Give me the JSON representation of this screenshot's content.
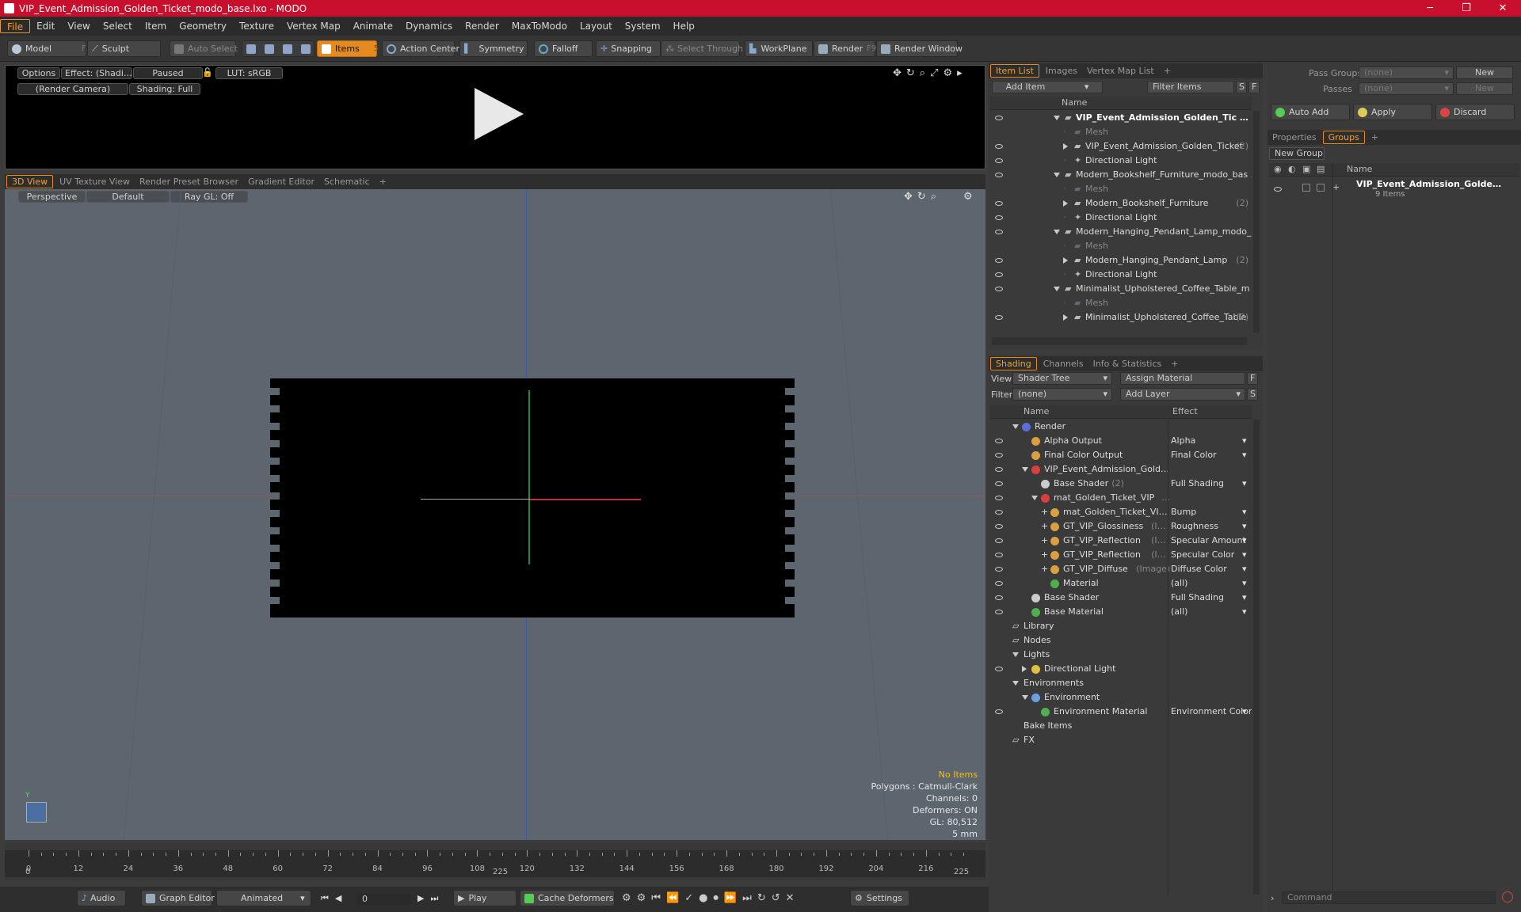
{
  "window": {
    "title": "VIP_Event_Admission_Golden_Ticket_modo_base.lxo - MODO",
    "minimize": "─",
    "maximize": "❐",
    "close": "✕"
  },
  "menu": [
    "File",
    "Edit",
    "View",
    "Select",
    "Item",
    "Geometry",
    "Texture",
    "Vertex Map",
    "Animate",
    "Dynamics",
    "Render",
    "MaxToModo",
    "Layout",
    "System",
    "Help"
  ],
  "toolbar": {
    "model": "Model",
    "model_key": "F2",
    "sculpt": "Sculpt",
    "auto_select": "Auto Select",
    "items": "Items",
    "items_key": "5",
    "action_center": "Action Center",
    "symmetry": "Symmetry",
    "falloff": "Falloff",
    "snapping": "Snapping",
    "select_through": "Select Through",
    "workplane": "WorkPlane",
    "render": "Render",
    "render_key": "F9",
    "render_window": "Render Window"
  },
  "preview": {
    "options": "Options",
    "effect": "Effect: (Shadi…",
    "paused": "Paused",
    "lut": "LUT: sRGB",
    "camera": "(Render Camera)",
    "shading": "Shading: Full"
  },
  "view_tabs": [
    "3D View",
    "UV Texture View",
    "Render Preset Browser",
    "Gradient Editor",
    "Schematic",
    "+"
  ],
  "viewport": {
    "perspective": "Perspective",
    "default": "Default",
    "raygl": "Ray GL: Off",
    "stats": {
      "no_items": "No Items",
      "polygons": "Polygons : Catmull-Clark",
      "channels": "Channels: 0",
      "deformers": "Deformers: ON",
      "gl": "GL: 80,512",
      "scale": "5 mm"
    }
  },
  "timeline": {
    "ticks": [
      0,
      12,
      24,
      36,
      48,
      60,
      72,
      84,
      96,
      108,
      120,
      132,
      144,
      156,
      168,
      180,
      192,
      204,
      216
    ],
    "start": "0",
    "mid": "225",
    "end": "225"
  },
  "transport": {
    "audio": "Audio",
    "graph_editor": "Graph Editor",
    "animated": "Animated",
    "frame": "0",
    "play": "Play",
    "cache_deformers": "Cache Deformers",
    "settings": "Settings"
  },
  "item_list": {
    "tabs": [
      "Item List",
      "Images",
      "Vertex Map List",
      "+"
    ],
    "add_item": "Add Item",
    "filter_items": "Filter Items",
    "s_btn": "S",
    "f_btn": "F",
    "col_name": "Name",
    "rows": [
      {
        "indent": 0,
        "text": "VIP_Event_Admission_Golden_Tic …",
        "style": "bold",
        "expand": "down"
      },
      {
        "indent": 1,
        "text": "Mesh",
        "style": "dim",
        "expand": ""
      },
      {
        "indent": 1,
        "text": "VIP_Event_Admission_Golden_Ticket",
        "suffix": "(2)",
        "style": "",
        "expand": "right"
      },
      {
        "indent": 1,
        "text": "Directional Light",
        "style": "",
        "expand": ""
      },
      {
        "indent": 0,
        "text": "Modern_Bookshelf_Furniture_modo_bas …",
        "style": "",
        "expand": "down"
      },
      {
        "indent": 1,
        "text": "Mesh",
        "style": "dim",
        "expand": ""
      },
      {
        "indent": 1,
        "text": "Modern_Bookshelf_Furniture",
        "suffix": "(2)",
        "style": "",
        "expand": "right"
      },
      {
        "indent": 1,
        "text": "Directional Light",
        "style": "",
        "expand": ""
      },
      {
        "indent": 0,
        "text": "Modern_Hanging_Pendant_Lamp_modo_…",
        "style": "",
        "expand": "down"
      },
      {
        "indent": 1,
        "text": "Mesh",
        "style": "dim",
        "expand": ""
      },
      {
        "indent": 1,
        "text": "Modern_Hanging_Pendant_Lamp",
        "suffix": "(2)",
        "style": "",
        "expand": "right"
      },
      {
        "indent": 1,
        "text": "Directional Light",
        "style": "",
        "expand": ""
      },
      {
        "indent": 0,
        "text": "Minimalist_Upholstered_Coffee_Table_m …",
        "style": "",
        "expand": "down"
      },
      {
        "indent": 1,
        "text": "Mesh",
        "style": "dim",
        "expand": ""
      },
      {
        "indent": 1,
        "text": "Minimalist_Upholstered_Coffee_Table",
        "suffix": "(2)",
        "style": "",
        "expand": "right"
      }
    ]
  },
  "shading": {
    "tabs": [
      "Shading",
      "Channels",
      "Info & Statistics",
      "+"
    ],
    "view_label": "View",
    "view_value": "Shader Tree",
    "assign_material": "Assign Material",
    "filter_label": "Filter",
    "filter_value": "(none)",
    "add_layer": "Add Layer",
    "f_btn": "F",
    "s_btn": "S",
    "col_name": "Name",
    "col_effect": "Effect",
    "rows": [
      {
        "indent": 0,
        "text": "Render",
        "effect": "",
        "color": "#5a6fd8",
        "expand": "down",
        "eye": false
      },
      {
        "indent": 1,
        "text": "Alpha Output",
        "effect": "Alpha",
        "color": "#d8a040",
        "expand": "",
        "eye": true
      },
      {
        "indent": 1,
        "text": "Final Color Output",
        "effect": "Final Color",
        "color": "#d8a040",
        "expand": "",
        "eye": true
      },
      {
        "indent": 1,
        "text": "VIP_Event_Admission_Gold…",
        "effect": "",
        "color": "#d84040",
        "expand": "down",
        "eye": true
      },
      {
        "indent": 2,
        "text": "Base Shader",
        "suffix": "(2)",
        "effect": "Full Shading",
        "color": "#cccccc",
        "expand": "",
        "eye": true
      },
      {
        "indent": 2,
        "text": "mat_Golden_Ticket_VIP",
        "suffix": "…",
        "effect": "",
        "color": "#d84040",
        "expand": "down",
        "eye": true
      },
      {
        "indent": 3,
        "text": "mat_Golden_Ticket_VI…",
        "effect": "Bump",
        "color": "#d8a040",
        "expand": "+",
        "eye": true
      },
      {
        "indent": 3,
        "text": "GT_VIP_Glossiness",
        "suffix": "(I…",
        "effect": "Roughness",
        "color": "#d8a040",
        "expand": "+",
        "eye": true
      },
      {
        "indent": 3,
        "text": "GT_VIP_Reflection",
        "suffix": "(I…",
        "effect": "Specular Amount",
        "color": "#d8a040",
        "expand": "+",
        "eye": true
      },
      {
        "indent": 3,
        "text": "GT_VIP_Reflection",
        "suffix": "(I…",
        "effect": "Specular Color",
        "color": "#d8a040",
        "expand": "+",
        "eye": true
      },
      {
        "indent": 3,
        "text": "GT_VIP_Diffuse",
        "suffix": "(Image)",
        "effect": "Diffuse Color",
        "color": "#d8a040",
        "expand": "+",
        "eye": true
      },
      {
        "indent": 3,
        "text": "Material",
        "effect": "(all)",
        "color": "#50b050",
        "expand": "",
        "eye": true
      },
      {
        "indent": 1,
        "text": "Base Shader",
        "effect": "Full Shading",
        "color": "#cccccc",
        "expand": "",
        "eye": true
      },
      {
        "indent": 1,
        "text": "Base Material",
        "effect": "(all)",
        "color": "#50b050",
        "expand": "",
        "eye": true
      },
      {
        "indent": 0,
        "text": "Library",
        "effect": "",
        "color": "",
        "expand": "folder",
        "eye": false
      },
      {
        "indent": 0,
        "text": "Nodes",
        "effect": "",
        "color": "",
        "expand": "folder",
        "eye": false
      },
      {
        "indent": -1,
        "text": "Lights",
        "effect": "",
        "color": "",
        "expand": "down",
        "eye": false
      },
      {
        "indent": 1,
        "text": "Directional Light",
        "effect": "",
        "color": "#e0c040",
        "expand": "right",
        "eye": true
      },
      {
        "indent": -1,
        "text": "Environments",
        "effect": "",
        "color": "",
        "expand": "down",
        "eye": false
      },
      {
        "indent": 1,
        "text": "Environment",
        "effect": "",
        "color": "#6aa0e0",
        "expand": "down",
        "eye": false
      },
      {
        "indent": 2,
        "text": "Environment Material",
        "effect": "Environment Color",
        "color": "#50b050",
        "expand": "",
        "eye": true
      },
      {
        "indent": -1,
        "text": "Bake Items",
        "effect": "",
        "color": "",
        "expand": "",
        "eye": false
      },
      {
        "indent": 0,
        "text": "FX",
        "effect": "",
        "color": "",
        "expand": "folder",
        "eye": false
      }
    ]
  },
  "right_panel": {
    "pass_groups_label": "Pass Groups",
    "pass_groups_value": "(none)",
    "passes_label": "Passes",
    "passes_value": "(none)",
    "new1": "New",
    "new2": "New",
    "auto_add": "Auto Add",
    "apply": "Apply",
    "discard": "Discard",
    "tabs": [
      "Properties",
      "Groups",
      "+"
    ],
    "new_group": "New Group",
    "col_name": "Name",
    "group_name": "VIP_Event_Admission_Golde…",
    "group_count": "9 Items",
    "command": "Command"
  }
}
